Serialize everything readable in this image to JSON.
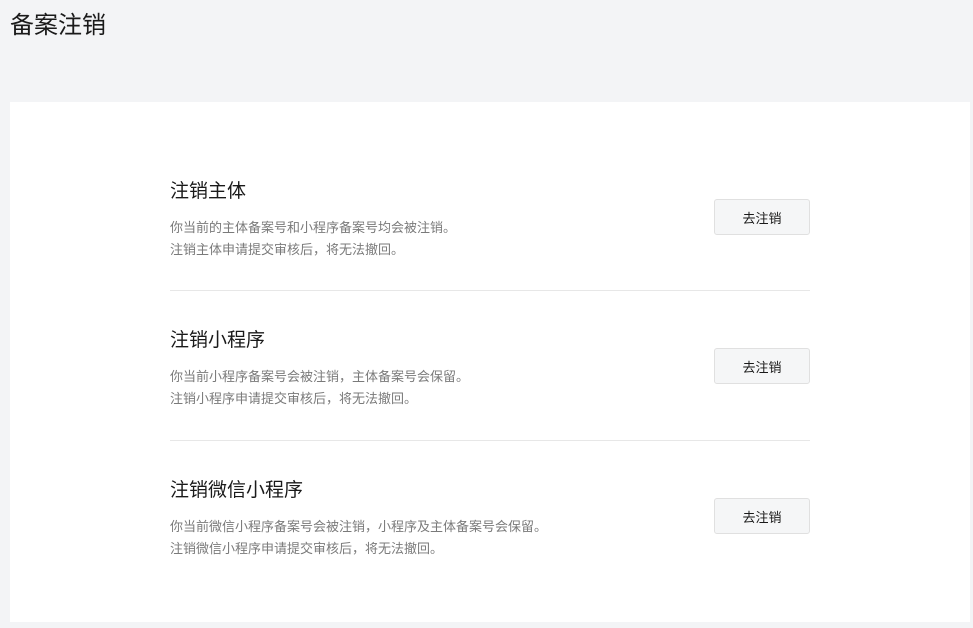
{
  "page": {
    "title": "备案注销"
  },
  "sections": [
    {
      "title": "注销主体",
      "desc_line1": "你当前的主体备案号和小程序备案号均会被注销。",
      "desc_line2": "注销主体申请提交审核后，将无法撤回。",
      "button_label": "去注销"
    },
    {
      "title": "注销小程序",
      "desc_line1": "你当前小程序备案号会被注销，主体备案号会保留。",
      "desc_line2": "注销小程序申请提交审核后，将无法撤回。",
      "button_label": "去注销"
    },
    {
      "title": "注销微信小程序",
      "desc_line1": "你当前微信小程序备案号会被注销，小程序及主体备案号会保留。",
      "desc_line2": "注销微信小程序申请提交审核后，将无法撤回。",
      "button_label": "去注销"
    }
  ]
}
